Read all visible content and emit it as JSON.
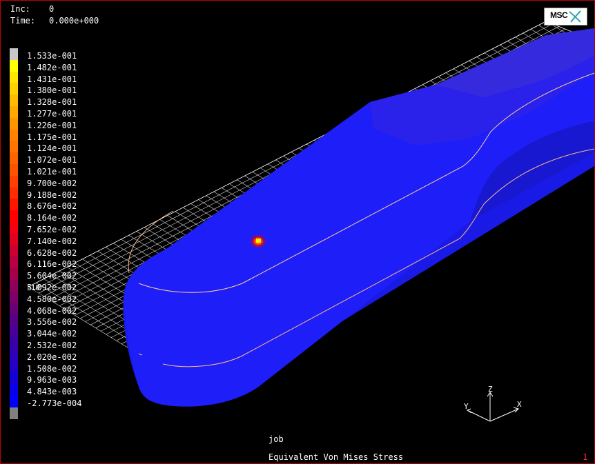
{
  "header": {
    "inc_label": "Inc:",
    "inc_value": "0",
    "time_label": "Time:",
    "time_value": "0.000e+000"
  },
  "logo": {
    "text": "MSC"
  },
  "legend": {
    "labels": [
      "1.533e-001",
      "1.482e-001",
      "1.431e-001",
      "1.380e-001",
      "1.328e-001",
      "1.277e-001",
      "1.226e-001",
      "1.175e-001",
      "1.124e-001",
      "1.072e-001",
      "1.021e-001",
      "9.700e-002",
      "9.188e-002",
      "8.676e-002",
      "8.164e-002",
      "7.652e-002",
      "7.140e-002",
      "6.628e-002",
      "6.116e-002",
      "5.604e-002",
      "5.092e-002",
      "4.580e-002",
      "4.068e-002",
      "3.556e-002",
      "3.044e-002",
      "2.532e-002",
      "2.020e-002",
      "1.508e-002",
      "9.963e-003",
      "4.843e-003",
      "-2.773e-004"
    ],
    "colors": [
      "#c8c8c8",
      "#ffff00",
      "#ffe600",
      "#ffd000",
      "#ffbb00",
      "#ffa600",
      "#ff9400",
      "#ff8300",
      "#ff7300",
      "#ff6200",
      "#ff5200",
      "#ff4000",
      "#ff2c00",
      "#ff1600",
      "#ff0000",
      "#f40010",
      "#e00020",
      "#cc0030",
      "#b80040",
      "#a4004c",
      "#900058",
      "#7c0068",
      "#680078",
      "#560088",
      "#460098",
      "#3a00a8",
      "#2e00b8",
      "#2200c8",
      "#1400d8",
      "#0800e8",
      "#0000ff",
      "#808080"
    ]
  },
  "triad": {
    "x": "X",
    "y": "Y",
    "z": "Z"
  },
  "footer": {
    "job": "job",
    "title": "Equivalent Von Mises Stress",
    "frame": "1"
  },
  "model_colors": {
    "part": "#1e1ef8",
    "part_dark": "#1414c8",
    "upper": "#3a2ee0",
    "edge": "#ffcc88",
    "hotspot": "#ffee00",
    "grid": "#ffffff"
  }
}
